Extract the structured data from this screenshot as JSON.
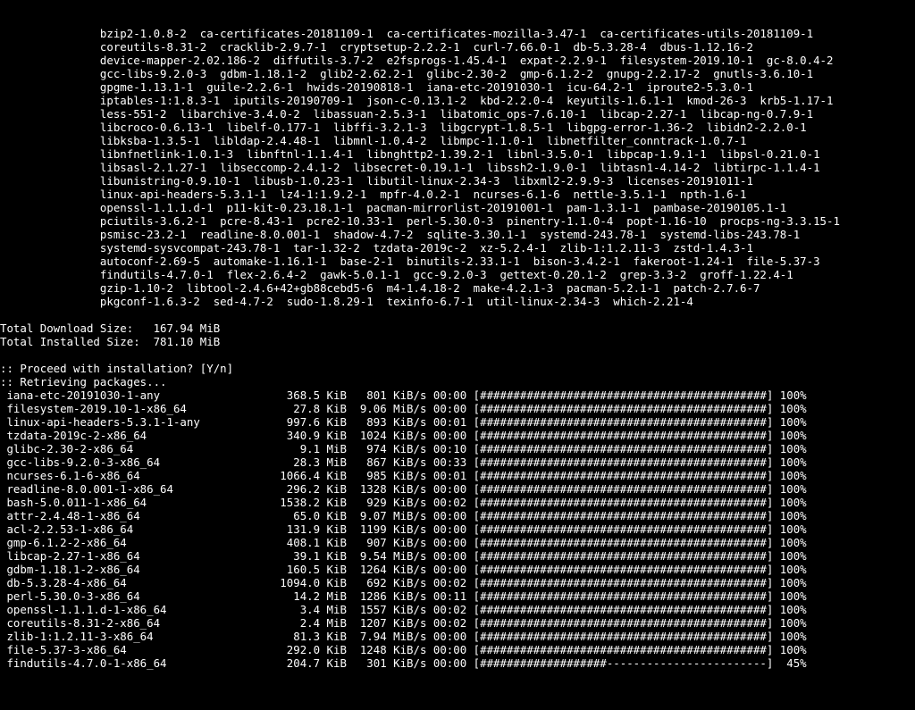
{
  "package_wrap_indent": "               ",
  "packages": [
    "bzip2-1.0.8-2",
    "ca-certificates-20181109-1",
    "ca-certificates-mozilla-3.47-1",
    "ca-certificates-utils-20181109-1",
    "coreutils-8.31-2",
    "cracklib-2.9.7-1",
    "cryptsetup-2.2.2-1",
    "curl-7.66.0-1",
    "db-5.3.28-4",
    "dbus-1.12.16-2",
    "device-mapper-2.02.186-2",
    "diffutils-3.7-2",
    "e2fsprogs-1.45.4-1",
    "expat-2.2.9-1",
    "filesystem-2019.10-1",
    "gc-8.0.4-2",
    "gcc-libs-9.2.0-3",
    "gdbm-1.18.1-2",
    "glib2-2.62.2-1",
    "glibc-2.30-2",
    "gmp-6.1.2-2",
    "gnupg-2.2.17-2",
    "gnutls-3.6.10-1",
    "gpgme-1.13.1-1",
    "guile-2.2.6-1",
    "hwids-20190818-1",
    "iana-etc-20191030-1",
    "icu-64.2-1",
    "iproute2-5.3.0-1",
    "iptables-1:1.8.3-1",
    "iputils-20190709-1",
    "json-c-0.13.1-2",
    "kbd-2.2.0-4",
    "keyutils-1.6.1-1",
    "kmod-26-3",
    "krb5-1.17-1",
    "less-551-2",
    "libarchive-3.4.0-2",
    "libassuan-2.5.3-1",
    "libatomic_ops-7.6.10-1",
    "libcap-2.27-1",
    "libcap-ng-0.7.9-1",
    "libcroco-0.6.13-1",
    "libelf-0.177-1",
    "libffi-3.2.1-3",
    "libgcrypt-1.8.5-1",
    "libgpg-error-1.36-2",
    "libidn2-2.2.0-1",
    "libksba-1.3.5-1",
    "libldap-2.4.48-1",
    "libmnl-1.0.4-2",
    "libmpc-1.1.0-1",
    "libnetfilter_conntrack-1.0.7-1",
    "libnfnetlink-1.0.1-3",
    "libnftnl-1.1.4-1",
    "libnghttp2-1.39.2-1",
    "libnl-3.5.0-1",
    "libpcap-1.9.1-1",
    "libpsl-0.21.0-1",
    "libsasl-2.1.27-1",
    "libseccomp-2.4.1-2",
    "libsecret-0.19.1-1",
    "libssh2-1.9.0-1",
    "libtasn1-4.14-2",
    "libtirpc-1.1.4-1",
    "libunistring-0.9.10-1",
    "libusb-1.0.23-1",
    "libutil-linux-2.34-3",
    "libxml2-2.9.9-3",
    "licenses-20191011-1",
    "linux-api-headers-5.3.1-1",
    "lz4-1:1.9.2-1",
    "mpfr-4.0.2-1",
    "ncurses-6.1-6",
    "nettle-3.5.1-1",
    "npth-1.6-1",
    "openssl-1.1.1.d-1",
    "p11-kit-0.23.18.1-1",
    "pacman-mirrorlist-20191001-1",
    "pam-1.3.1-1",
    "pambase-20190105.1-1",
    "pciutils-3.6.2-1",
    "pcre-8.43-1",
    "pcre2-10.33-1",
    "perl-5.30.0-3",
    "pinentry-1.1.0-4",
    "popt-1.16-10",
    "procps-ng-3.3.15-1",
    "psmisc-23.2-1",
    "readline-8.0.001-1",
    "shadow-4.7-2",
    "sqlite-3.30.1-1",
    "systemd-243.78-1",
    "systemd-libs-243.78-1",
    "systemd-sysvcompat-243.78-1",
    "tar-1.32-2",
    "tzdata-2019c-2",
    "xz-5.2.4-1",
    "zlib-1:1.2.11-3",
    "zstd-1.4.3-1",
    "autoconf-2.69-5",
    "automake-1.16.1-1",
    "base-2-1",
    "binutils-2.33.1-1",
    "bison-3.4.2-1",
    "fakeroot-1.24-1",
    "file-5.37-3",
    "findutils-4.7.0-1",
    "flex-2.6.4-2",
    "gawk-5.0.1-1",
    "gcc-9.2.0-3",
    "gettext-0.20.1-2",
    "grep-3.3-2",
    "groff-1.22.4-1",
    "gzip-1.10-2",
    "libtool-2.4.6+42+gb88cebd5-6",
    "m4-1.4.18-2",
    "make-4.2.1-3",
    "pacman-5.2.1-1",
    "patch-2.7.6-7",
    "pkgconf-1.6.3-2",
    "sed-4.7-2",
    "sudo-1.8.29-1",
    "texinfo-6.7-1",
    "util-linux-2.34-3",
    "which-2.21-4"
  ],
  "totals": {
    "download_label": "Total Download Size:   ",
    "download_value": "167.94 MiB",
    "installed_label": "Total Installed Size:  ",
    "installed_value": "781.10 MiB"
  },
  "prompt": ":: Proceed with installation? [Y/n]",
  "retrieving": ":: Retrieving packages...",
  "downloads": [
    {
      "name": "iana-etc-20191030-1-any",
      "size": "368.5 KiB",
      "rate": "801 KiB/s",
      "time": "00:00",
      "pct": 100
    },
    {
      "name": "filesystem-2019.10-1-x86_64",
      "size": "27.8 KiB",
      "rate": "9.06 MiB/s",
      "time": "00:00",
      "pct": 100
    },
    {
      "name": "linux-api-headers-5.3.1-1-any",
      "size": "997.6 KiB",
      "rate": "893 KiB/s",
      "time": "00:01",
      "pct": 100
    },
    {
      "name": "tzdata-2019c-2-x86_64",
      "size": "340.9 KiB",
      "rate": "1024 KiB/s",
      "time": "00:00",
      "pct": 100
    },
    {
      "name": "glibc-2.30-2-x86_64",
      "size": "9.1 MiB",
      "rate": "974 KiB/s",
      "time": "00:10",
      "pct": 100
    },
    {
      "name": "gcc-libs-9.2.0-3-x86_64",
      "size": "28.3 MiB",
      "rate": "867 KiB/s",
      "time": "00:33",
      "pct": 100
    },
    {
      "name": "ncurses-6.1-6-x86_64",
      "size": "1066.4 KiB",
      "rate": "985 KiB/s",
      "time": "00:01",
      "pct": 100
    },
    {
      "name": "readline-8.0.001-1-x86_64",
      "size": "296.2 KiB",
      "rate": "1328 KiB/s",
      "time": "00:00",
      "pct": 100
    },
    {
      "name": "bash-5.0.011-1-x86_64",
      "size": "1538.2 KiB",
      "rate": "929 KiB/s",
      "time": "00:02",
      "pct": 100
    },
    {
      "name": "attr-2.4.48-1-x86_64",
      "size": "65.0 KiB",
      "rate": "9.07 MiB/s",
      "time": "00:00",
      "pct": 100
    },
    {
      "name": "acl-2.2.53-1-x86_64",
      "size": "131.9 KiB",
      "rate": "1199 KiB/s",
      "time": "00:00",
      "pct": 100
    },
    {
      "name": "gmp-6.1.2-2-x86_64",
      "size": "408.1 KiB",
      "rate": "907 KiB/s",
      "time": "00:00",
      "pct": 100
    },
    {
      "name": "libcap-2.27-1-x86_64",
      "size": "39.1 KiB",
      "rate": "9.54 MiB/s",
      "time": "00:00",
      "pct": 100
    },
    {
      "name": "gdbm-1.18.1-2-x86_64",
      "size": "160.5 KiB",
      "rate": "1264 KiB/s",
      "time": "00:00",
      "pct": 100
    },
    {
      "name": "db-5.3.28-4-x86_64",
      "size": "1094.0 KiB",
      "rate": "692 KiB/s",
      "time": "00:02",
      "pct": 100
    },
    {
      "name": "perl-5.30.0-3-x86_64",
      "size": "14.2 MiB",
      "rate": "1286 KiB/s",
      "time": "00:11",
      "pct": 100
    },
    {
      "name": "openssl-1.1.1.d-1-x86_64",
      "size": "3.4 MiB",
      "rate": "1557 KiB/s",
      "time": "00:02",
      "pct": 100
    },
    {
      "name": "coreutils-8.31-2-x86_64",
      "size": "2.4 MiB",
      "rate": "1207 KiB/s",
      "time": "00:02",
      "pct": 100
    },
    {
      "name": "zlib-1:1.2.11-3-x86_64",
      "size": "81.3 KiB",
      "rate": "7.94 MiB/s",
      "time": "00:00",
      "pct": 100
    },
    {
      "name": "file-5.37-3-x86_64",
      "size": "292.0 KiB",
      "rate": "1248 KiB/s",
      "time": "00:00",
      "pct": 100
    },
    {
      "name": "findutils-4.7.0-1-x86_64",
      "size": "204.7 KiB",
      "rate": "301 KiB/s",
      "time": "00:00",
      "pct": 45
    }
  ],
  "bar_total_width": 43
}
